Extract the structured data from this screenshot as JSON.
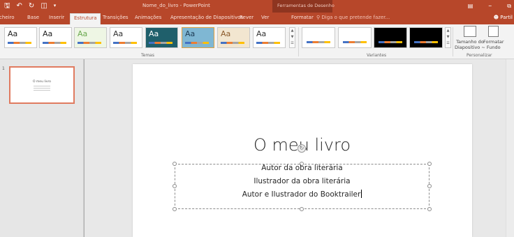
{
  "app": {
    "title": "Nome_do_livro - PowerPoint",
    "context_header": "Ferramentas de Desenho"
  },
  "qat": {
    "save_icon": "save-icon",
    "undo_icon": "undo-icon",
    "redo_icon": "redo-icon",
    "present_icon": "start-from-beginning-icon"
  },
  "tabs": [
    {
      "label": "cheiro"
    },
    {
      "label": "Base"
    },
    {
      "label": "Inserir"
    },
    {
      "label": "Estrutura"
    },
    {
      "label": "Transições"
    },
    {
      "label": "Animações"
    },
    {
      "label": "Apresentação de Diapositivos"
    },
    {
      "label": "Rever"
    },
    {
      "label": "Ver"
    },
    {
      "label": "Formatar"
    }
  ],
  "active_tab": "Estrutura",
  "tell_me": "Diga o que pretende fazer...",
  "share": "Partil",
  "ribbon": {
    "themes_group_label": "Temas",
    "variants_group_label": "Variantes",
    "customize_group_label": "Personalizar",
    "themes": [
      {
        "aa": "Aa",
        "bg": "#ffffff",
        "fg": "#222222"
      },
      {
        "aa": "Aa",
        "bg": "#ffffff",
        "fg": "#222222"
      },
      {
        "aa": "Aa",
        "bg": "#eef6e4",
        "fg": "#6aa84f"
      },
      {
        "aa": "Aa",
        "bg": "#ffffff",
        "fg": "#333333"
      },
      {
        "aa": "Aa",
        "bg": "#1f5f6b",
        "fg": "#ffffff"
      },
      {
        "aa": "Aa",
        "bg": "#7fb7d3",
        "fg": "#1f3c55"
      },
      {
        "aa": "Aa",
        "bg": "#f2e6d0",
        "fg": "#8b5a2b"
      },
      {
        "aa": "Aa",
        "bg": "#ffffff",
        "fg": "#333333"
      }
    ],
    "variants": [
      {
        "bg": "#ffffff"
      },
      {
        "bg": "#ffffff"
      },
      {
        "bg": "#000000"
      },
      {
        "bg": "#000000"
      }
    ],
    "slide_size_label_1": "Tamanho do",
    "slide_size_label_2": "Diapositivo ~",
    "format_bg_label_1": "Formatar",
    "format_bg_label_2": "Fundo"
  },
  "thumbnail": {
    "number": "1",
    "title": "O meu livro"
  },
  "slide": {
    "title": "O meu livro",
    "subtitle_lines": [
      "Autor da obra literária",
      "Ilustrador da obra literária",
      "Autor e Ilustrador do Booktrailer"
    ]
  }
}
